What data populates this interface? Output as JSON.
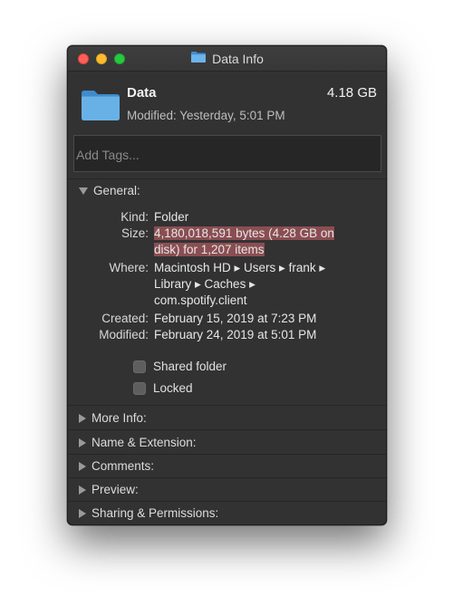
{
  "window": {
    "title": "Data Info",
    "icon": "folder-icon"
  },
  "header": {
    "name": "Data",
    "size": "4.18 GB",
    "modified": "Modified: Yesterday, 5:01 PM"
  },
  "tags": {
    "placeholder": "Add Tags..."
  },
  "general": {
    "label": "General:",
    "expanded": true,
    "kind_label": "Kind:",
    "kind": "Folder",
    "size_label": "Size:",
    "size_line1": "4,180,018,591 bytes (4.28 GB on",
    "size_line2": "disk) for 1,207 items",
    "where_label": "Where:",
    "where_line1": "Macintosh HD ▸ Users ▸ frank ▸",
    "where_line2": "Library ▸ Caches ▸",
    "where_line3": "com.spotify.client",
    "created_label": "Created:",
    "created": "February 15, 2019 at 7:23 PM",
    "modified_label": "Modified:",
    "modified": "February 24, 2019 at 5:01 PM",
    "shared_folder": "Shared folder",
    "locked": "Locked"
  },
  "sections": {
    "more_info": "More Info:",
    "name_extension": "Name & Extension:",
    "comments": "Comments:",
    "preview": "Preview:",
    "sharing": "Sharing & Permissions:"
  },
  "colors": {
    "window_bg": "#323232",
    "highlight": "#8a4e52",
    "folder_blue": "#5fa8e0"
  }
}
